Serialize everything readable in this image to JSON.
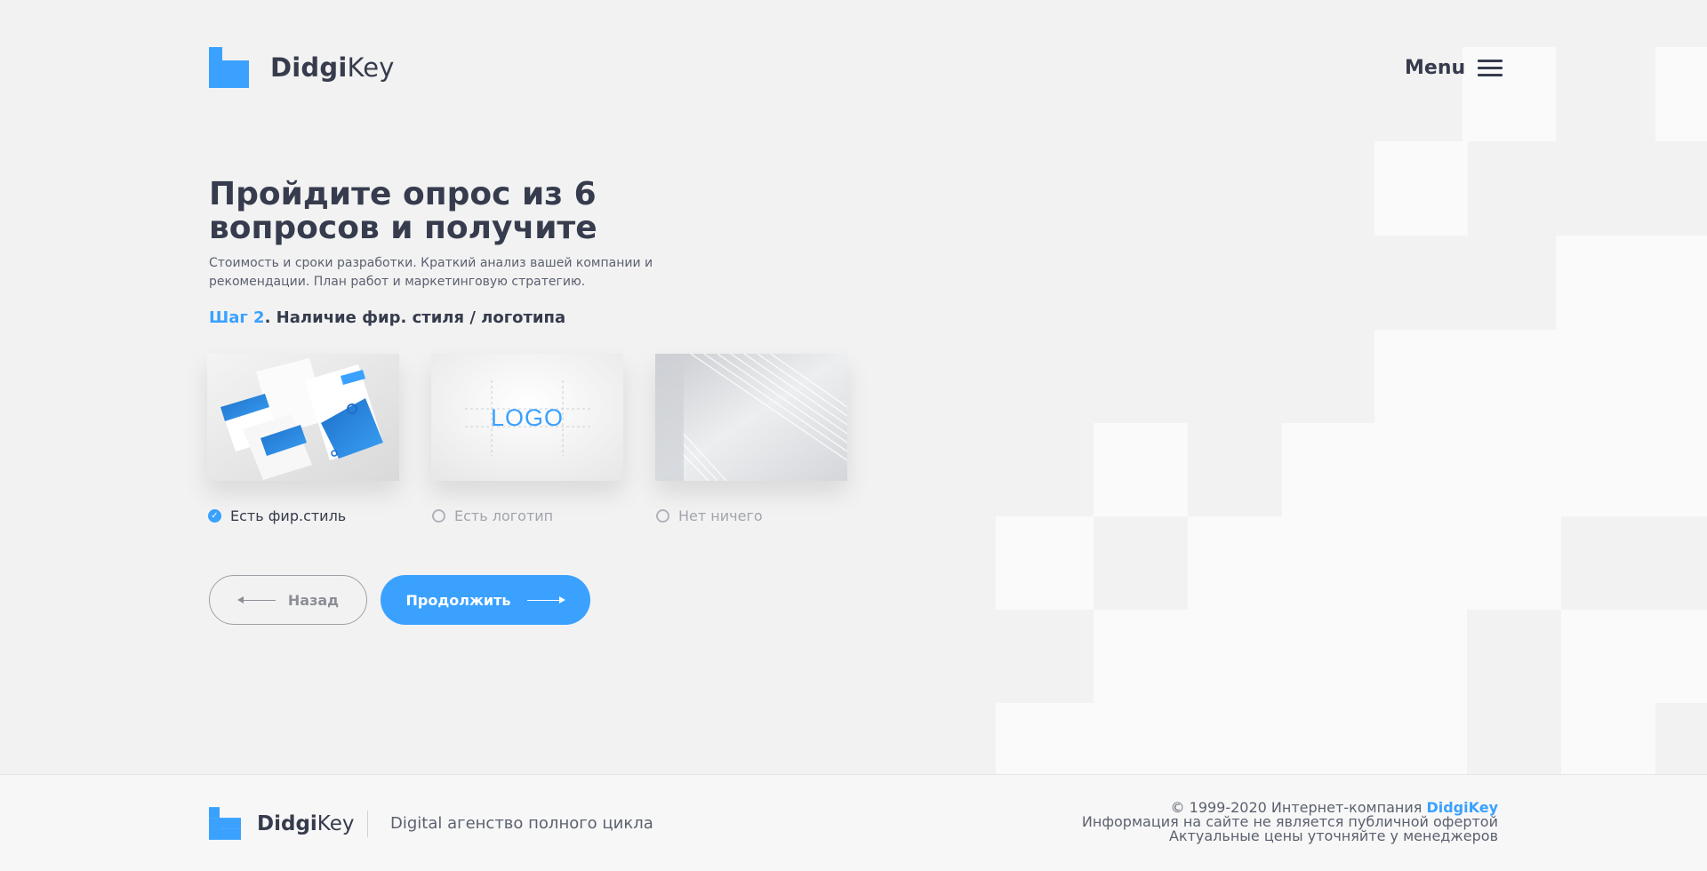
{
  "header": {
    "logo_bold": "Didgi",
    "logo_light": "Key",
    "menu_label": "Menu"
  },
  "hero": {
    "title": "Пройдите опрос из 6 вопросов и получите",
    "subtitle": "Стоимость и сроки разработки. Краткий анализ вашей компании и рекомендации. План работ и маркетинговую стратегию."
  },
  "step": {
    "number_label": "Шаг 2",
    "title": ". Наличие фир. стиля / логотипа"
  },
  "options": [
    {
      "label": "Есть фир.стиль",
      "checked": true,
      "image": "brand-identity-mockup"
    },
    {
      "label": "Есть логотип",
      "checked": false,
      "image": "logo-sketch",
      "image_text": "LOGO"
    },
    {
      "label": "Нет ничего",
      "checked": false,
      "image": "empty-abstract"
    }
  ],
  "buttons": {
    "back": "Назад",
    "next": "Продолжить"
  },
  "footer": {
    "logo_bold": "Didgi",
    "logo_light": "Key",
    "tagline": "Digital агенство полного цикла",
    "copyright_prefix": "© 1999-2020 Интернет-компания ",
    "copyright_brand": "DidgiKey",
    "disclaimer": "Информация на сайте не является публичной офертой",
    "prices_note": "Актуальные цены уточняйте у менеджеров"
  },
  "colors": {
    "accent": "#3aa1ff",
    "text": "#363c4d",
    "background": "#f2f2f2"
  }
}
